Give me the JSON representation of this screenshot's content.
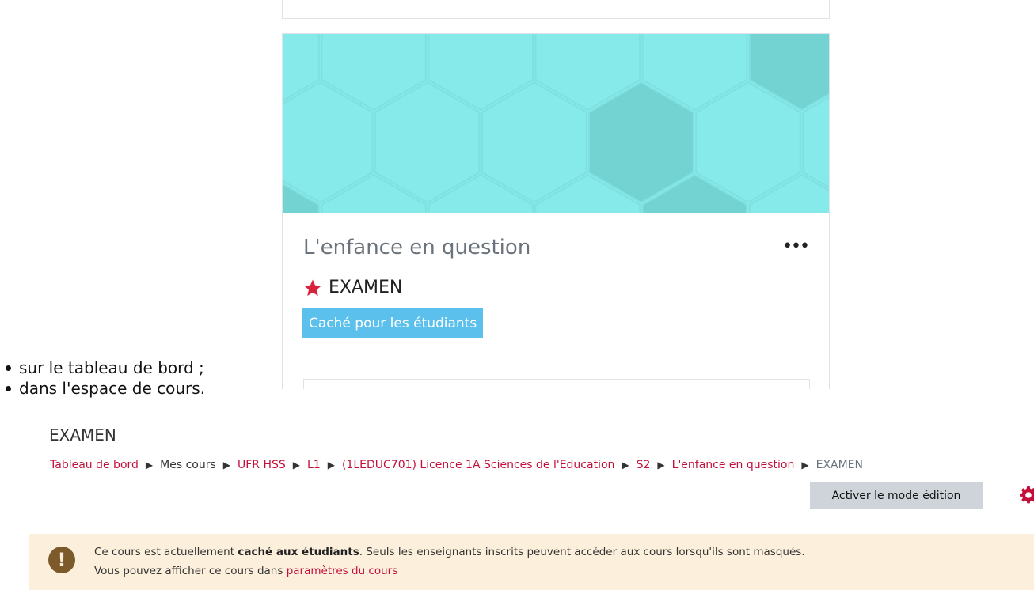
{
  "course_card": {
    "title": "L'enfance en question",
    "more_menu": "•••",
    "short_name": "EXAMEN",
    "hidden_badge": "Caché pour les étudiants"
  },
  "bullets": [
    "sur le tableau de bord ;",
    "dans l'espace de cours."
  ],
  "page_header": {
    "title": "EXAMEN",
    "breadcrumb": [
      {
        "label": "Tableau de bord",
        "link": true
      },
      {
        "label": "Mes cours",
        "link": false
      },
      {
        "label": "UFR HSS",
        "link": true
      },
      {
        "label": "L1",
        "link": true
      },
      {
        "label": "(1LEDUC701) Licence 1A Sciences de l'Education",
        "link": true
      },
      {
        "label": "S2",
        "link": true
      },
      {
        "label": "L'enfance en question",
        "link": true
      },
      {
        "label": "EXAMEN",
        "link": false
      }
    ],
    "separator": "▶",
    "edit_button": "Activer le mode édition"
  },
  "alert": {
    "line1_pre": "Ce cours est actuellement ",
    "line1_bold": "caché aux étudiants",
    "line1_post": ". Seuls les enseignants inscrits peuvent accéder aux cours lorsqu'ils sont masqués.",
    "line2_pre": "Vous pouvez afficher ce cours dans ",
    "line2_link": "paramètres du cours",
    "icon": "!"
  },
  "colors": {
    "accent": "#c3103a",
    "badge": "#5bc0eb",
    "alert_bg": "#fcefdc",
    "hex_light": "#86e9ea",
    "hex_dark": "#73d3d3"
  },
  "icons": [
    "star-icon",
    "gear-icon",
    "exclamation-icon",
    "more-icon"
  ]
}
